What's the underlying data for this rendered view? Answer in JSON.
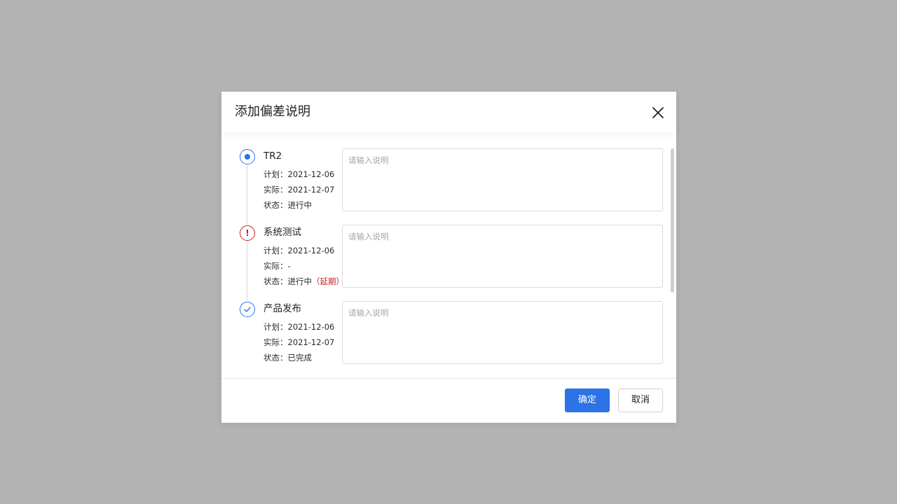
{
  "dialog": {
    "title": "添加偏差说明",
    "close_icon": "close-icon",
    "confirm_label": "确定",
    "cancel_label": "取消"
  },
  "milestones": [
    {
      "name": "TR2",
      "status_icon": "current-dot-icon",
      "plan": "计划：2021-12-06",
      "actual": "实际：2021-12-07",
      "status": "状态：进行中",
      "status_note": "",
      "placeholder": "请输入说明"
    },
    {
      "name": "系统测试",
      "status_icon": "warning-icon",
      "plan": "计划：2021-12-06",
      "actual": "实际：-",
      "status": "状态：进行中",
      "status_note": "（延期）",
      "placeholder": "请输入说明"
    },
    {
      "name": "产品发布",
      "status_icon": "check-circle-icon",
      "plan": "计划：2021-12-06",
      "actual": "实际：2021-12-07",
      "status": "状态：已完成",
      "status_note": "",
      "placeholder": "请输入说明"
    }
  ],
  "colors": {
    "overlay": "#b3b3b3",
    "primary": "#2b73e6",
    "danger": "#c81e1e"
  }
}
